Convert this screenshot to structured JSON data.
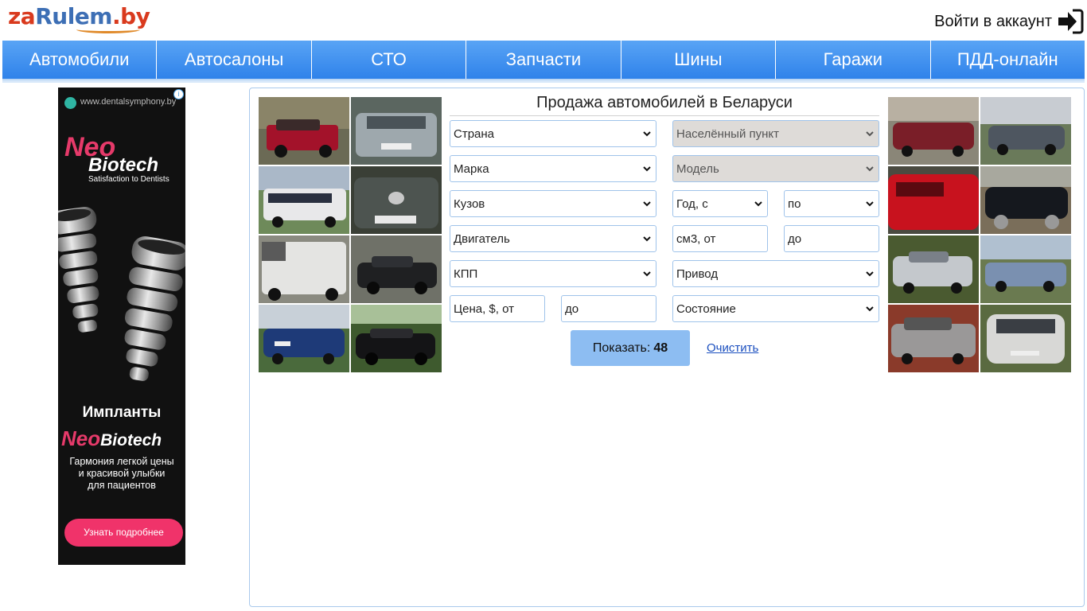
{
  "logo": {
    "part1": "za",
    "part2": "Rulem",
    "part3": ".by"
  },
  "login": {
    "label": "Войти в аккаунт",
    "icon": "sign-in-icon"
  },
  "nav": [
    {
      "label": "Автомобили"
    },
    {
      "label": "Автосалоны"
    },
    {
      "label": "СТО"
    },
    {
      "label": "Запчасти"
    },
    {
      "label": "Шины"
    },
    {
      "label": "Гаражи"
    },
    {
      "label": "ПДД-онлайн"
    }
  ],
  "ad": {
    "url": "www.dentalsymphony.by",
    "brand_top": "Neo",
    "brand_bottom": "Biotech",
    "tagline": "Satisfaction to Dentists",
    "title": "Импланты",
    "brand2_a": "Neo",
    "brand2_b": "Biotech",
    "desc_line1": "Гармония легкой цены",
    "desc_line2": "и красивой улыбки",
    "desc_line3": "для пациентов",
    "button": "Узнать подробнее",
    "info": "i"
  },
  "search": {
    "title": "Продажа автомобилей в Беларуси",
    "country": "Страна",
    "locality": "Населённый пункт",
    "brand": "Марка",
    "model": "Модель",
    "body": "Кузов",
    "year_from": "Год, с",
    "year_to": "по",
    "engine": "Двигатель",
    "cc_from": "см3, от",
    "cc_to": "до",
    "gearbox": "КПП",
    "drive": "Привод",
    "price_from": "Цена, $, от",
    "price_to": "до",
    "condition": "Состояние",
    "show_label": "Показать:",
    "show_count": "48",
    "clear": "Очистить"
  },
  "colors": {
    "nav_top": "#59a4f5",
    "nav_bottom": "#2f82ea",
    "panel_border": "#a9c9ec",
    "button": "#8dbdf2",
    "link": "#1b4fbf"
  }
}
